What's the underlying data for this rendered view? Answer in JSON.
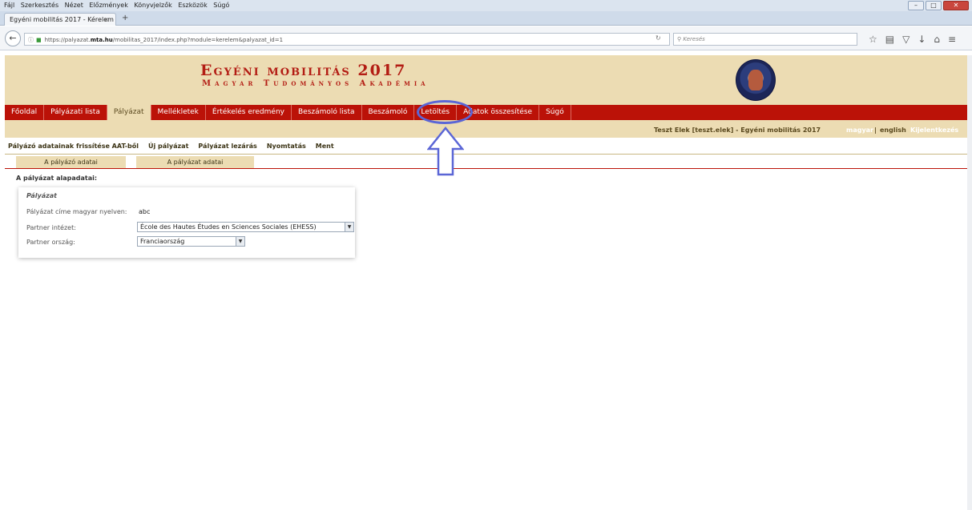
{
  "browser": {
    "menu": [
      "Fájl",
      "Szerkesztés",
      "Nézet",
      "Előzmények",
      "Könyvjelzők",
      "Eszközök",
      "Súgó"
    ],
    "tab_title": "Egyéni mobilitás 2017 - Kérelem",
    "tab_close": "×",
    "new_tab": "+",
    "url_prefix": "https://palyazat.",
    "url_host": "mta.hu",
    "url_path": "/mobilitas_2017/index.php?module=kerelem&palyazat_id=1",
    "search_placeholder": "Keresés",
    "window_buttons": [
      "–",
      "□",
      "✕"
    ]
  },
  "header": {
    "title": "Egyéni mobilitás 2017",
    "subtitle": "Magyar Tudományos Akadémia"
  },
  "nav": {
    "items": [
      "Főoldal",
      "Pályázati lista",
      "Pályázat",
      "Mellékletek",
      "Értékelés eredmény",
      "Beszámoló lista",
      "Beszámoló",
      "Letöltés",
      "Adatok összesítése",
      "Súgó"
    ],
    "active_index": 2
  },
  "userbar": {
    "user": "Teszt Elek [teszt.elek] - Egyéni mobilitás 2017",
    "lang_hu": "magyar",
    "separator": "|",
    "lang_en": "english",
    "logout": "Kijelentkezés"
  },
  "actions": [
    "Pályázó adatainak frissítése AAT-ből",
    "Új pályázat",
    "Pályázat lezárás",
    "Nyomtatás",
    "Ment"
  ],
  "subtabs": [
    "A pályázó adatai",
    "A pályázat adatai"
  ],
  "section_title": "A pályázat alapadatai:",
  "form": {
    "legend": "Pályázat",
    "title_label": "Pályázat címe magyar nyelven:",
    "title_value": "abc",
    "institute_label": "Partner intézet:",
    "institute_value": "École des Hautes Études en Sciences Sociales (EHESS)",
    "country_label": "Partner ország:",
    "country_value": "Franciaország"
  },
  "colors": {
    "brand_red": "#bb1208",
    "header_beige": "#ecdcb3",
    "annotation_blue": "#5b66d6"
  }
}
